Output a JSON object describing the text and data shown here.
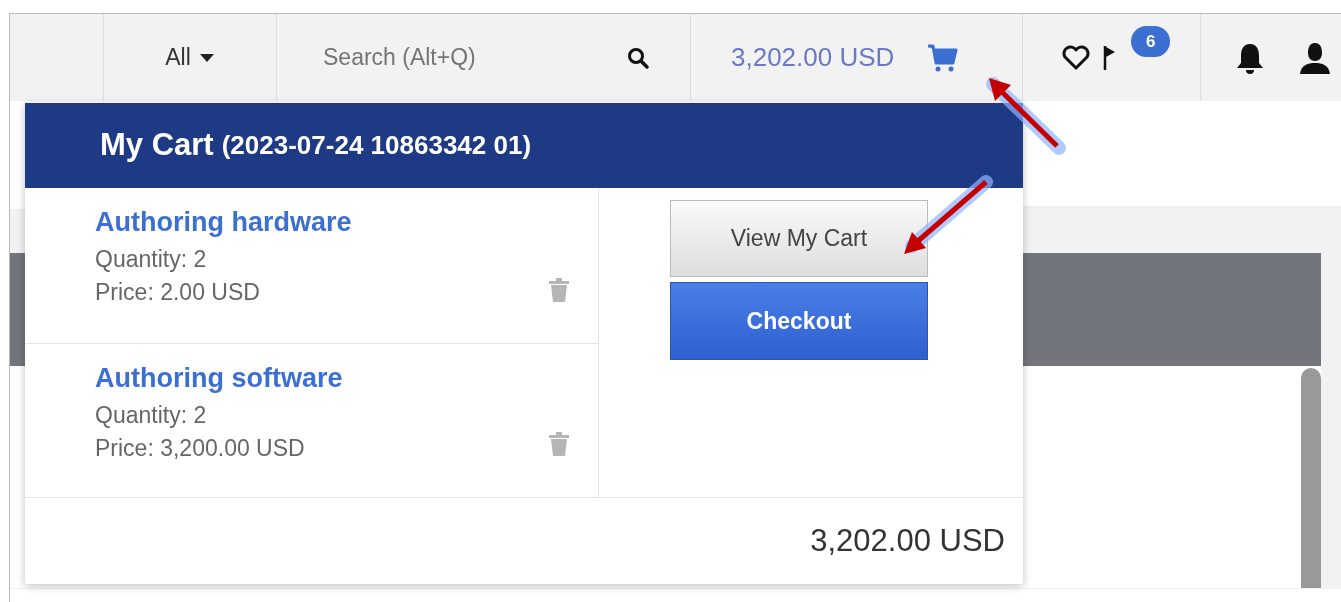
{
  "top_bar": {
    "scope": "All",
    "search": {
      "placeholder": "Search (Alt+Q)"
    },
    "cart_total": "3,202.00 USD",
    "notification_badge": "6"
  },
  "cart_menu": {
    "title": "My Cart",
    "cart_id": "(2023-07-24 10863342 01)",
    "items": [
      {
        "name": "Authoring hardware",
        "quantity": "Quantity: 2",
        "price": "Price: 2.00 USD"
      },
      {
        "name": "Authoring software",
        "quantity": "Quantity: 2",
        "price": "Price: 3,200.00 USD"
      }
    ],
    "buttons": [
      {
        "label": "View My Cart",
        "kind": "secondary"
      },
      {
        "label": "Checkout",
        "kind": "primary"
      }
    ],
    "total": "3,202.00 USD"
  }
}
